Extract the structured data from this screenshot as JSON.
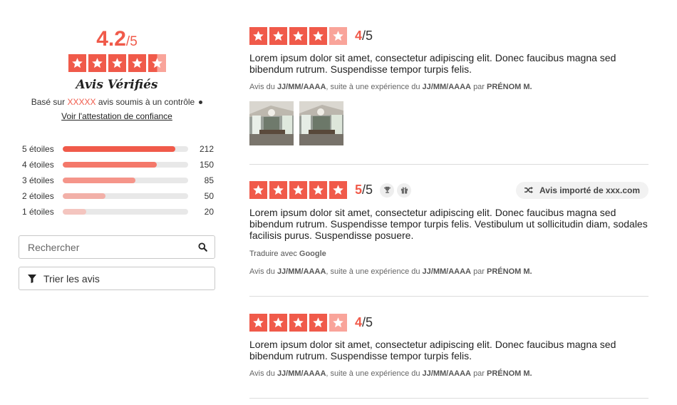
{
  "summary": {
    "score": "4.2",
    "score_out": "/5",
    "stars": 4.2,
    "verified_title": "Avis Vérifiés",
    "based_prefix": "Basé sur",
    "based_count": "XXXXX",
    "based_suffix": "avis soumis à un contrôle",
    "attestation_link": "Voir l'attestation de confiance"
  },
  "distribution": [
    {
      "label": "5 étoiles",
      "count": "212",
      "ratio": 0.9,
      "color": "#f05a4a"
    },
    {
      "label": "4 étoiles",
      "count": "150",
      "ratio": 0.75,
      "color": "#f4786a"
    },
    {
      "label": "3 étoiles",
      "count": "85",
      "ratio": 0.58,
      "color": "#f5958a"
    },
    {
      "label": "2 étoiles",
      "count": "50",
      "ratio": 0.34,
      "color": "#f2b0a8"
    },
    {
      "label": "1 étoiles",
      "count": "20",
      "ratio": 0.19,
      "color": "#f4c5bf"
    }
  ],
  "search": {
    "placeholder": "Rechercher"
  },
  "sort": {
    "label": "Trier les avis"
  },
  "reviews": [
    {
      "stars": 4,
      "rating": "4",
      "rating_out": "/5",
      "text": "Lorem ipsum dolor sit amet, consectetur adipiscing elit. Donec faucibus magna sed bibendum rutrum. Suspendisse tempor turpis felis.",
      "meta_pre": "Avis du",
      "review_date": "JJ/MM/AAAA",
      "meta_mid": ", suite à une expérience du",
      "exp_date": "JJ/MM/AAAA",
      "meta_by": "par",
      "author": "PRÉNOM M."
    },
    {
      "stars": 5,
      "rating": "5",
      "rating_out": "/5",
      "imported_label": "Avis importé de xxx.com",
      "text": "Lorem ipsum dolor sit amet, consectetur adipiscing elit. Donec faucibus magna sed bibendum rutrum. Suspendisse tempor turpis felis. Vestibulum ut sollicitudin diam, sodales facilisis purus. Suspendisse posuere.",
      "translate_label": "Traduire avec",
      "translate_brand": "Google",
      "meta_pre": "Avis du",
      "review_date": "JJ/MM/AAAA",
      "meta_mid": ", suite à une expérience du",
      "exp_date": "JJ/MM/AAAA",
      "meta_by": "par",
      "author": "PRÉNOM M."
    },
    {
      "stars": 4,
      "rating": "4",
      "rating_out": "/5",
      "text": "Lorem ipsum dolor sit amet, consectetur adipiscing elit. Donec faucibus magna sed bibendum rutrum. Suspendisse tempor turpis felis.",
      "meta_pre": "Avis du",
      "review_date": "JJ/MM/AAAA",
      "meta_mid": ", suite à une expérience du",
      "exp_date": "JJ/MM/AAAA",
      "meta_by": "par",
      "author": "PRÉNOM M."
    }
  ],
  "colors": {
    "accent": "#f05a4a",
    "accent_light": "#f9a49a",
    "divider": "#dcdcdc"
  },
  "icons": {
    "search": "search-icon",
    "filter": "filter-icon",
    "shuffle": "shuffle-icon",
    "trophy": "trophy-icon",
    "gift": "gift-icon"
  }
}
